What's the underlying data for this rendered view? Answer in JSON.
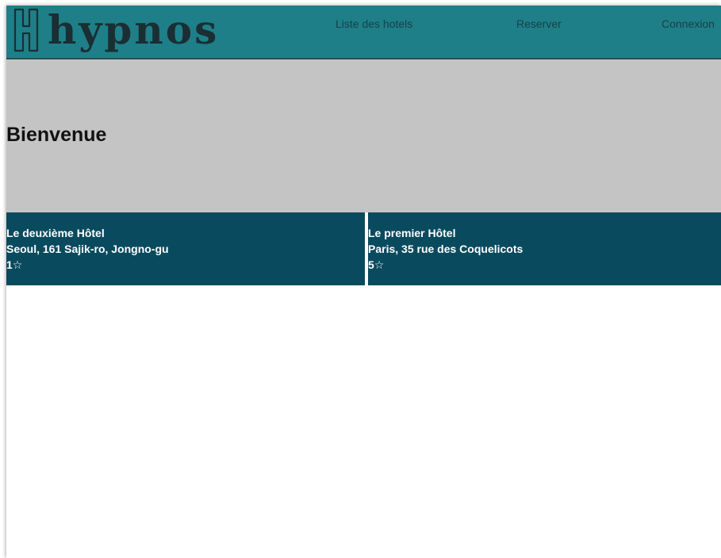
{
  "header": {
    "logo_text": "hypnos",
    "nav": {
      "hotels_label": "Liste des hotels",
      "reserve_label": "Reserver",
      "login_label": "Connexion"
    }
  },
  "hero": {
    "title": "Bienvenue"
  },
  "hotels": [
    {
      "name": "Le deuxième Hôtel",
      "address": "Seoul, 161 Sajik-ro, Jongno-gu",
      "rating": "1☆"
    },
    {
      "name": "Le premier Hôtel",
      "address": "Paris, 35 rue des Coquelicots",
      "rating": "5☆"
    }
  ],
  "colors": {
    "header_bg": "#1e7f88",
    "hero_bg": "#c4c4c4",
    "card_bg": "#0a4a5f",
    "logo": "#1a2e33"
  }
}
